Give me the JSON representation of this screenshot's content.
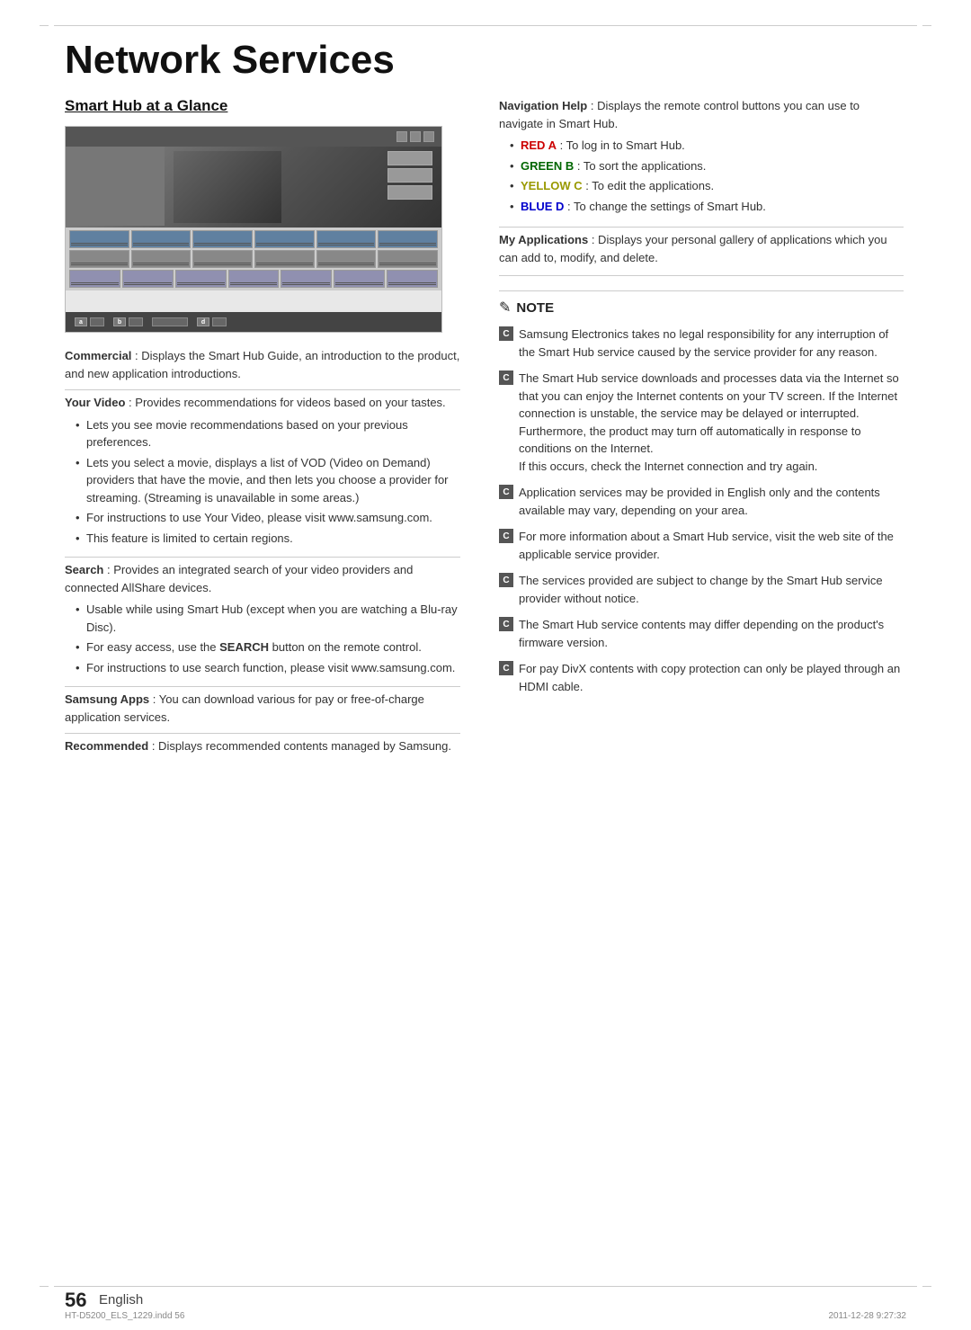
{
  "page": {
    "title": "Network Services",
    "number": "56",
    "language": "English",
    "footer_left": "HT-D5200_ELS_1229.indd  56",
    "footer_right": "2011-12-28   9:27:32"
  },
  "left_column": {
    "section_title": "Smart Hub at a Glance",
    "blocks": [
      {
        "id": "commercial",
        "title": "Commercial",
        "text": " : Displays the Smart Hub Guide, an introduction to the product, and new application introductions."
      },
      {
        "id": "your_video",
        "title": "Your Video",
        "text": " : Provides recommendations for videos based on your tastes.",
        "bullets": [
          "Lets you see movie recommendations based on your previous preferences.",
          "Lets you select a movie, displays a list of VOD (Video on Demand) providers that have the movie, and then lets you choose a provider for streaming. (Streaming is unavailable in some areas.)",
          "For instructions to use Your Video, please visit www.samsung.com.",
          "This feature is limited to certain regions."
        ]
      },
      {
        "id": "search",
        "title": "Search",
        "text": " : Provides an integrated search of your video providers and connected AllShare devices.",
        "bullets": [
          "Usable while using Smart Hub (except when you are watching a Blu-ray Disc).",
          "For easy access, use the SEARCH button on the remote control.",
          "For instructions to use search function, please visit www.samsung.com."
        ],
        "search_bold": "SEARCH"
      },
      {
        "id": "samsung_apps",
        "title": "Samsung Apps",
        "text": " : You can download various for pay or free-of-charge application services."
      },
      {
        "id": "recommended",
        "title": "Recommended",
        "text": " : Displays recommended contents managed by Samsung."
      }
    ]
  },
  "right_column": {
    "blocks": [
      {
        "id": "navigation_help",
        "title": "Navigation Help",
        "text": " : Displays the remote control buttons you can use to navigate in Smart Hub.",
        "bullets": [
          {
            "color": "red",
            "label": "RED  A",
            "text": " : To log in to Smart Hub."
          },
          {
            "color": "green",
            "label": "GREEN  B",
            "text": " : To sort the applications."
          },
          {
            "color": "yellow",
            "label": "YELLOW  C",
            "text": " : To edit the applications."
          },
          {
            "color": "blue",
            "label": "BLUE  D",
            "text": " : To change the settings of Smart Hub."
          }
        ]
      },
      {
        "id": "my_applications",
        "title": "My Applications",
        "text": " : Displays your personal gallery of applications which you can add to, modify, and delete."
      }
    ],
    "note": {
      "label": "NOTE",
      "items": [
        {
          "badge": "C",
          "text": "Samsung Electronics takes no legal responsibility for any interruption of the Smart Hub service caused by the service provider for any reason."
        },
        {
          "badge": "C",
          "text": "The Smart Hub service downloads and processes data via the Internet so that you can enjoy the Internet contents on your TV screen. If the Internet connection is unstable, the service may be delayed or interrupted. Furthermore, the product may turn off automatically in response to conditions on the Internet.\nIf this occurs, check the Internet connection and try again."
        },
        {
          "badge": "C",
          "text": "Application services may be provided in English only and the contents available may vary, depending on your area."
        },
        {
          "badge": "C",
          "text": "For more information about a Smart Hub service, visit the web site of the applicable service provider."
        },
        {
          "badge": "C",
          "text": "The services provided are subject to change by the Smart Hub service provider without notice."
        },
        {
          "badge": "C",
          "text": "The Smart Hub service contents may differ depending on the product's firmware version."
        },
        {
          "badge": "C",
          "text": "For pay DivX contents with copy protection can only be played through an HDMI cable."
        }
      ]
    }
  }
}
